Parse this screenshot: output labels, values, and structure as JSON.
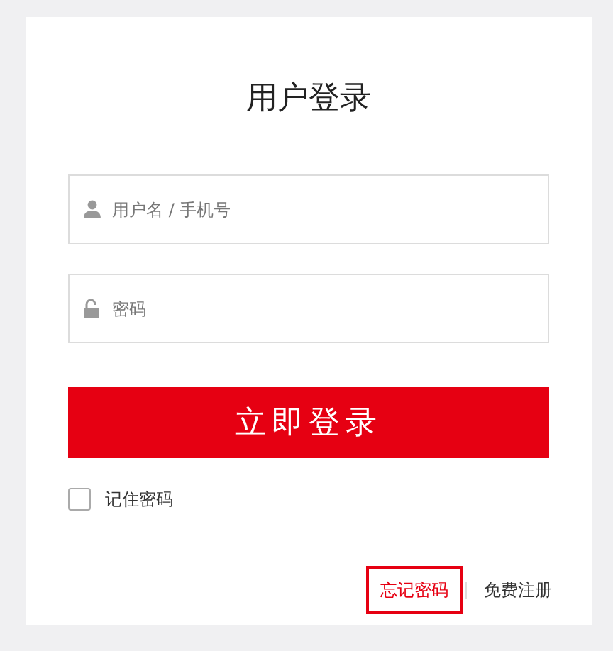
{
  "title": "用户登录",
  "fields": [
    {
      "kind": "user",
      "placeholder": "用户名 / 手机号"
    },
    {
      "kind": "password",
      "placeholder": "密码"
    }
  ],
  "submit": "立即登录",
  "remember": {
    "label": "记住密码",
    "checked": false
  },
  "links": [
    {
      "label": "忘记密码",
      "focused": true
    },
    {
      "label": "免费注册",
      "focused": false
    }
  ]
}
